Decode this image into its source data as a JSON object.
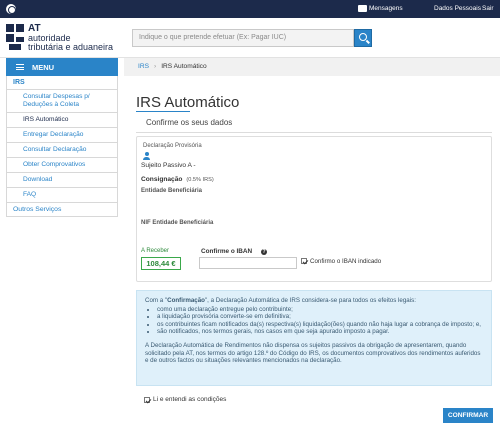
{
  "topbar": {
    "messages": "Mensagens",
    "personal_data": "Dados Pessoais",
    "logout": "Sair"
  },
  "header": {
    "logo_line1": "AT",
    "logo_line2": "autoridade",
    "logo_line3": "tributária e aduaneira",
    "search_placeholder": "Indique o que pretende efetuar (Ex: Pagar IUC)"
  },
  "sidebar": {
    "menu_label": "MENU",
    "section": "IRS",
    "items": [
      {
        "label_1": "Consultar Despesas p/",
        "label_2": "Deduções à Coleta"
      },
      {
        "label_1": "IRS Automático",
        "label_2": ""
      },
      {
        "label_1": "Entregar Declaração",
        "label_2": ""
      },
      {
        "label_1": "Consultar Declaração",
        "label_2": ""
      },
      {
        "label_1": "Obter Comprovativos",
        "label_2": ""
      },
      {
        "label_1": "Download",
        "label_2": ""
      },
      {
        "label_1": "FAQ",
        "label_2": ""
      }
    ],
    "other": "Outros Serviços"
  },
  "breadcrumb": {
    "home": "IRS",
    "current": "IRS Automático"
  },
  "main": {
    "title": "IRS Automático",
    "subtitle": "Confirme os seus dados",
    "provisional_label": "Declaração Provisória",
    "taxpayer_label": "Sujeito Passivo A -",
    "consignment_label": "Consignação",
    "consignment_value": "(0.5% IRS)",
    "beneficiary_label": "Entidade Beneficiária",
    "beneficiary_nif_label": "NIF Entidade Beneficiária",
    "receive_label": "A Receber",
    "receive_amount": "108,44 €",
    "iban_label": "Confirme o IBAN",
    "iban_value": "",
    "iban_checkbox_label": "Confirmo o IBAN indicado",
    "iban_checked": true
  },
  "info": {
    "intro_bold": "Confirmação",
    "intro_pre": "Com a \"",
    "intro_post": "\", a Declaração Automática de IRS considera-se para todos os efeitos legais:",
    "bullets": [
      "como uma declaração entregue pelo contribuinte;",
      "a liquidação provisória converte-se em definitiva;",
      "os contribuintes ficam notificados da(s) respectiva(s) liquidação(ões) quando não haja lugar a cobrança de imposto; e,",
      "são notificados, nos termos gerais, nos casos em que seja apurado imposto a pagar."
    ],
    "paragraph": "A Declaração Automática de Rendimentos não dispensa os sujeitos passivos da obrigação de apresentarem, quando solicitado pela AT, nos termos do artigo 128.º do Código do IRS, os documentos comprovativos dos rendimentos auferidos e de outros factos ou situações relevantes mencionados na declaração."
  },
  "accept": {
    "label": "Li e entendi as condições",
    "checked": true
  },
  "actions": {
    "confirm": "CONFIRMAR"
  },
  "colors": {
    "navy": "#1c2a4b",
    "accent": "#2a84c8",
    "success": "#2d8a3b",
    "info_bg": "#dff0fa"
  }
}
